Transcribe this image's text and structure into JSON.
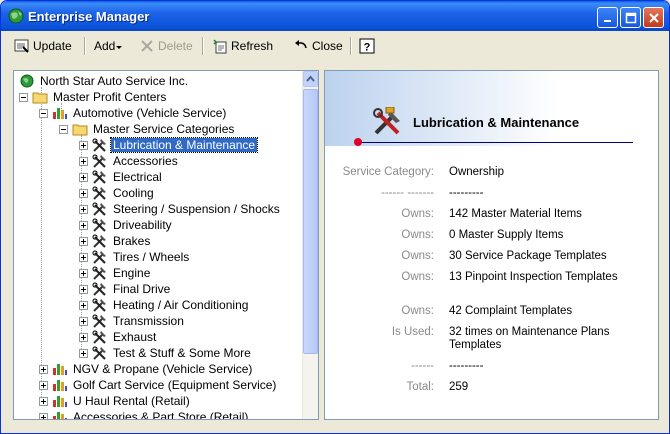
{
  "window": {
    "title": "Enterprise Manager"
  },
  "toolbar": {
    "update": "Update",
    "add": "Add",
    "delete": "Delete",
    "refresh": "Refresh",
    "close": "Close"
  },
  "tree": {
    "root": "North Star Auto Service Inc.",
    "master_profit_centers": "Master Profit Centers",
    "automotive": "Automotive (Vehicle Service)",
    "master_service_categories": "Master Service Categories",
    "categories": [
      "Lubrication & Maintenance",
      "Accessories",
      "Electrical",
      "Cooling",
      "Steering / Suspension / Shocks",
      "Driveability",
      "Brakes",
      "Tires / Wheels",
      "Engine",
      "Final Drive",
      "Heating / Air Conditioning",
      "Transmission",
      "Exhaust",
      "Test & Stuff & Some More"
    ],
    "profit_centers": [
      "NGV & Propane (Vehicle Service)",
      "Golf Cart Service  (Equipment Service)",
      "U Haul Rental  (Retail)",
      "Accessories & Part Store (Retail)"
    ]
  },
  "detail": {
    "title": "Lubrication & Maintenance",
    "service_category_label": "Service Category:",
    "service_category_value": "Ownership",
    "sep1_label": "------ -------",
    "sep1_value": "---------",
    "rows": [
      {
        "label": "Owns:",
        "value": "142 Master Material Items"
      },
      {
        "label": "Owns:",
        "value": "0 Master Supply Items"
      },
      {
        "label": "Owns:",
        "value": "30 Service Package Templates"
      },
      {
        "label": "Owns:",
        "value": "13 Pinpoint Inspection Templates"
      },
      {
        "label": "Owns:",
        "value": "42 Complaint Templates"
      },
      {
        "label": "Is Used:",
        "value": "32 times on Maintenance Plans Templates"
      }
    ],
    "sep2_label": "------",
    "sep2_value": "---------",
    "total_label": "Total:",
    "total_value": "259"
  }
}
